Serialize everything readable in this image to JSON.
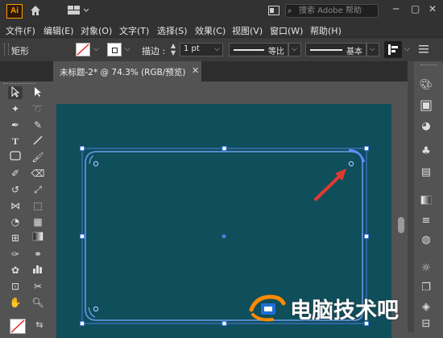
{
  "app": {
    "logo": "Ai"
  },
  "search": {
    "placeholder": "搜索 Adobe 帮助"
  },
  "menu": [
    "文件(F)",
    "编辑(E)",
    "对象(O)",
    "文字(T)",
    "选择(S)",
    "效果(C)",
    "视图(V)",
    "窗口(W)",
    "帮助(H)"
  ],
  "control": {
    "tool_name": "矩形",
    "stroke_label": "描边 :",
    "stroke_value": "1 pt",
    "profile_label": "等比",
    "brush_label": "基本"
  },
  "document": {
    "tab_title": "未标题-2* @ 74.3% (RGB/预览)"
  },
  "watermark": {
    "text": "电脑技术吧"
  },
  "colors": {
    "artboard": "#0f4e5b",
    "selection": "#4d7fe0",
    "accent": "#ff9a00",
    "arrow": "#e03a2f"
  }
}
